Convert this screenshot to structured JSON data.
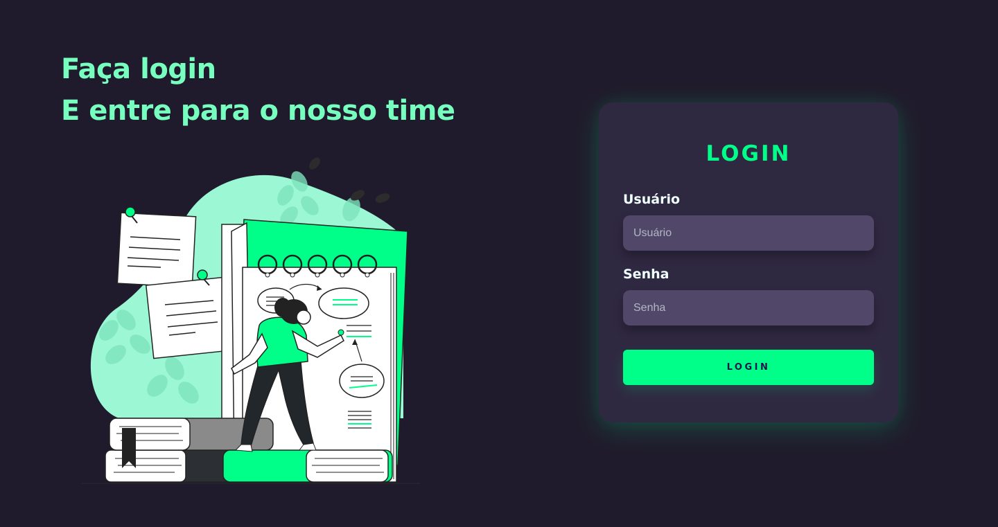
{
  "left": {
    "headline_line1": "Faça login",
    "headline_line2": "E entre para o nosso time"
  },
  "card": {
    "title": "LOGIN",
    "username_label": "Usuário",
    "username_placeholder": "Usuário",
    "username_value": "",
    "password_label": "Senha",
    "password_placeholder": "Senha",
    "password_value": "",
    "submit_label": "LOGIN"
  },
  "colors": {
    "background": "#201b2c",
    "headline": "#77ffc0",
    "accent": "#00ff88",
    "card": "#2f2841",
    "input": "#514869"
  },
  "icons": {
    "illustration": "woman-writing-on-notepad-illustration"
  }
}
